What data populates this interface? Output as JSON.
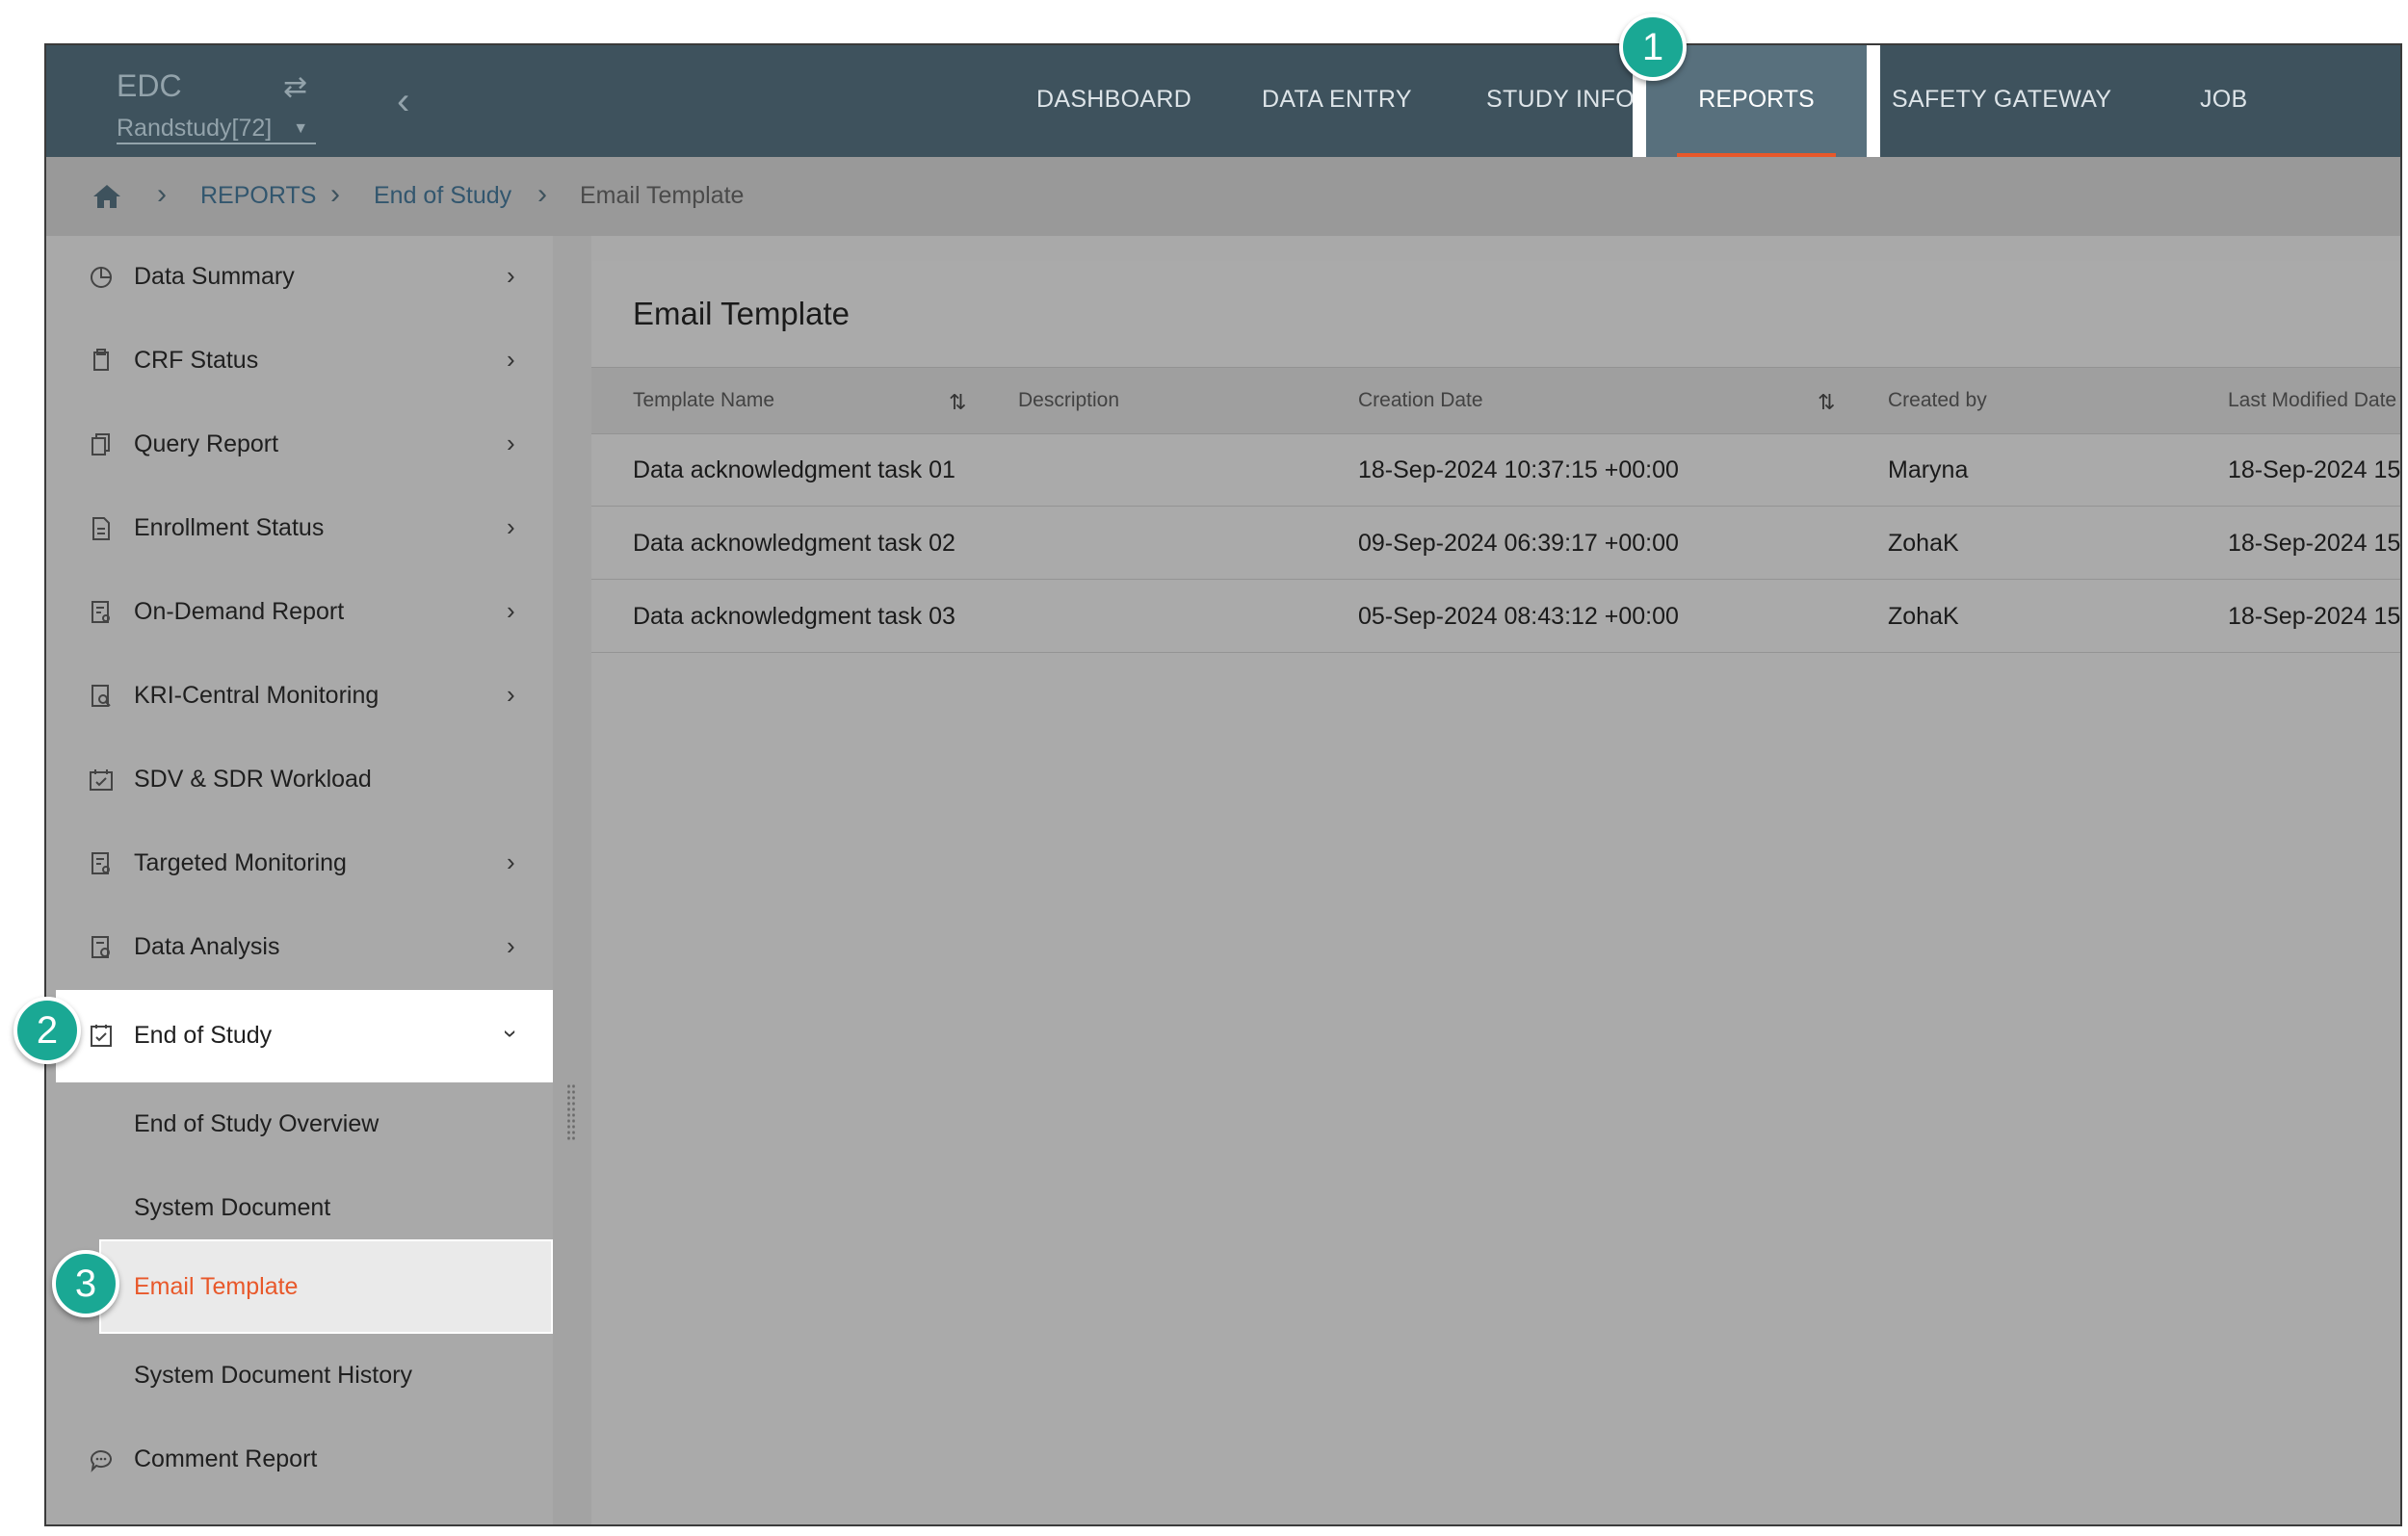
{
  "topbar": {
    "app_name": "EDC",
    "study_selector": "Randstudy[72]",
    "nav": [
      "DASHBOARD",
      "DATA ENTRY",
      "STUDY INFO",
      "REPORTS",
      "SAFETY GATEWAY",
      "JOB"
    ],
    "active_nav": "REPORTS"
  },
  "breadcrumb": [
    "REPORTS",
    "End of Study",
    "Email Template"
  ],
  "sidebar": {
    "items": [
      {
        "label": "Data Summary",
        "icon": "pie-chart-icon",
        "has_submenu": true
      },
      {
        "label": "CRF Status",
        "icon": "copy-icon",
        "has_submenu": true
      },
      {
        "label": "Query Report",
        "icon": "pages-icon",
        "has_submenu": true
      },
      {
        "label": "Enrollment Status",
        "icon": "document-icon",
        "has_submenu": true
      },
      {
        "label": "On-Demand Report",
        "icon": "report-icon",
        "has_submenu": true
      },
      {
        "label": "KRI-Central Monitoring",
        "icon": "monitor-report-icon",
        "has_submenu": true
      },
      {
        "label": "SDV & SDR Workload",
        "icon": "calendar-check-icon",
        "has_submenu": false
      },
      {
        "label": "Targeted Monitoring",
        "icon": "report-icon",
        "has_submenu": true
      },
      {
        "label": "Data Analysis",
        "icon": "analysis-icon",
        "has_submenu": true
      },
      {
        "label": "End of Study",
        "icon": "clipboard-check-icon",
        "has_submenu": true,
        "expanded": true
      },
      {
        "label": "End of Study Overview",
        "sub": true
      },
      {
        "label": "System Document",
        "sub": true
      },
      {
        "label": "Email Template",
        "sub": true,
        "active": true
      },
      {
        "label": "System Document History",
        "sub": true
      },
      {
        "label": "Comment Report",
        "icon": "comment-icon",
        "has_submenu": false
      }
    ]
  },
  "main": {
    "title": "Email Template",
    "columns": [
      "Template Name",
      "Description",
      "Creation Date",
      "Created by",
      "Last Modified Date"
    ],
    "rows": [
      {
        "name": "Data acknowledgment task 01",
        "description": "",
        "created": "18-Sep-2024 10:37:15 +00:00",
        "created_by": "Maryna",
        "modified": "18-Sep-2024 15:"
      },
      {
        "name": "Data acknowledgment task 02",
        "description": "",
        "created": "09-Sep-2024 06:39:17 +00:00",
        "created_by": "ZohaK",
        "modified": "18-Sep-2024 15:"
      },
      {
        "name": "Data acknowledgment task 03",
        "description": "",
        "created": "05-Sep-2024 08:43:12 +00:00",
        "created_by": "ZohaK",
        "modified": "18-Sep-2024 15:"
      }
    ]
  },
  "callouts": [
    "1",
    "2",
    "3"
  ],
  "colors": {
    "topbar": "#3e525d",
    "accent": "#e8582a",
    "badge": "#1aa894"
  }
}
